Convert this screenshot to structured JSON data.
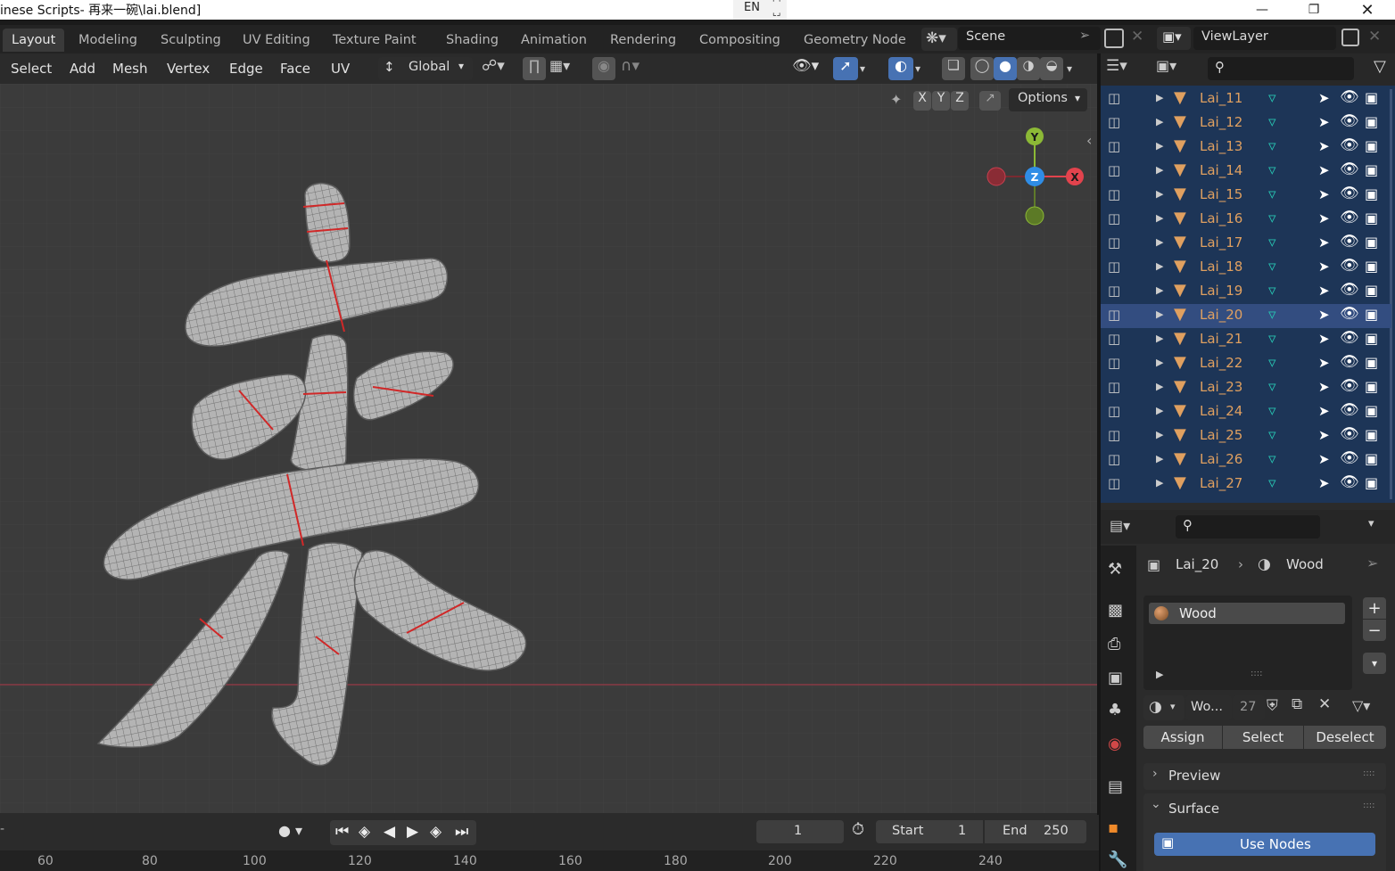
{
  "window": {
    "title": "inese Scripts- 再来一碗\\lai.blend]",
    "lang": "EN"
  },
  "workspaces": [
    "Layout",
    "Modeling",
    "Sculpting",
    "UV Editing",
    "Texture Paint",
    "Shading",
    "Animation",
    "Rendering",
    "Compositing",
    "Geometry Node"
  ],
  "scene": {
    "label": "Scene",
    "view_layer": "ViewLayer"
  },
  "viewport_header": {
    "menus": [
      "Select",
      "Add",
      "Mesh",
      "Vertex",
      "Edge",
      "Face",
      "UV"
    ],
    "orientation": "Global",
    "options": "Options",
    "axes": [
      "X",
      "Y",
      "Z"
    ]
  },
  "gizmo": {
    "y": "Y",
    "z": "Z",
    "x": "X"
  },
  "outliner": {
    "items": [
      "Lai_11",
      "Lai_12",
      "Lai_13",
      "Lai_14",
      "Lai_15",
      "Lai_16",
      "Lai_17",
      "Lai_18",
      "Lai_19",
      "Lai_20",
      "Lai_21",
      "Lai_22",
      "Lai_23",
      "Lai_24",
      "Lai_25",
      "Lai_26",
      "Lai_27"
    ],
    "active": "Lai_20"
  },
  "properties": {
    "object": "Lai_20",
    "material": "Wood",
    "slot": "Wood",
    "mat_short": "Wo...",
    "users": "27",
    "assign": "Assign",
    "select": "Select",
    "deselect": "Deselect",
    "preview": "Preview",
    "surface": "Surface",
    "use_nodes": "Use Nodes"
  },
  "timeline": {
    "frame": "1",
    "start_label": "Start",
    "start": "1",
    "end_label": "End",
    "end": "250",
    "ruler": [
      "60",
      "80",
      "100",
      "120",
      "140",
      "160",
      "180",
      "200",
      "220",
      "240"
    ]
  },
  "colors": {
    "accent": "#4772b3",
    "selection": "#1d3557",
    "active_row": "#334d80",
    "orange": "#e0a060",
    "red_axis": "#e2434d",
    "green_axis": "#8cb936",
    "blue_axis": "#2f8de6"
  }
}
